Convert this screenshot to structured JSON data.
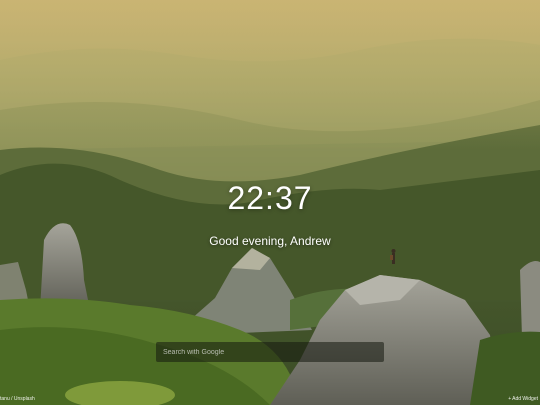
{
  "clock": {
    "time": "22:37"
  },
  "greeting": {
    "text": "Good evening, Andrew"
  },
  "search": {
    "placeholder": "Search with Google"
  },
  "footer": {
    "credit": "tanu / Unsplash",
    "add_widget_icon": "+",
    "add_widget_label": "Add Widget"
  },
  "colors": {
    "sky": "#b9a66a",
    "distant_hills": "#8f955d",
    "forest": "#44552b",
    "rock": "#8a8a7f"
  },
  "icons": [
    "plus-icon"
  ]
}
